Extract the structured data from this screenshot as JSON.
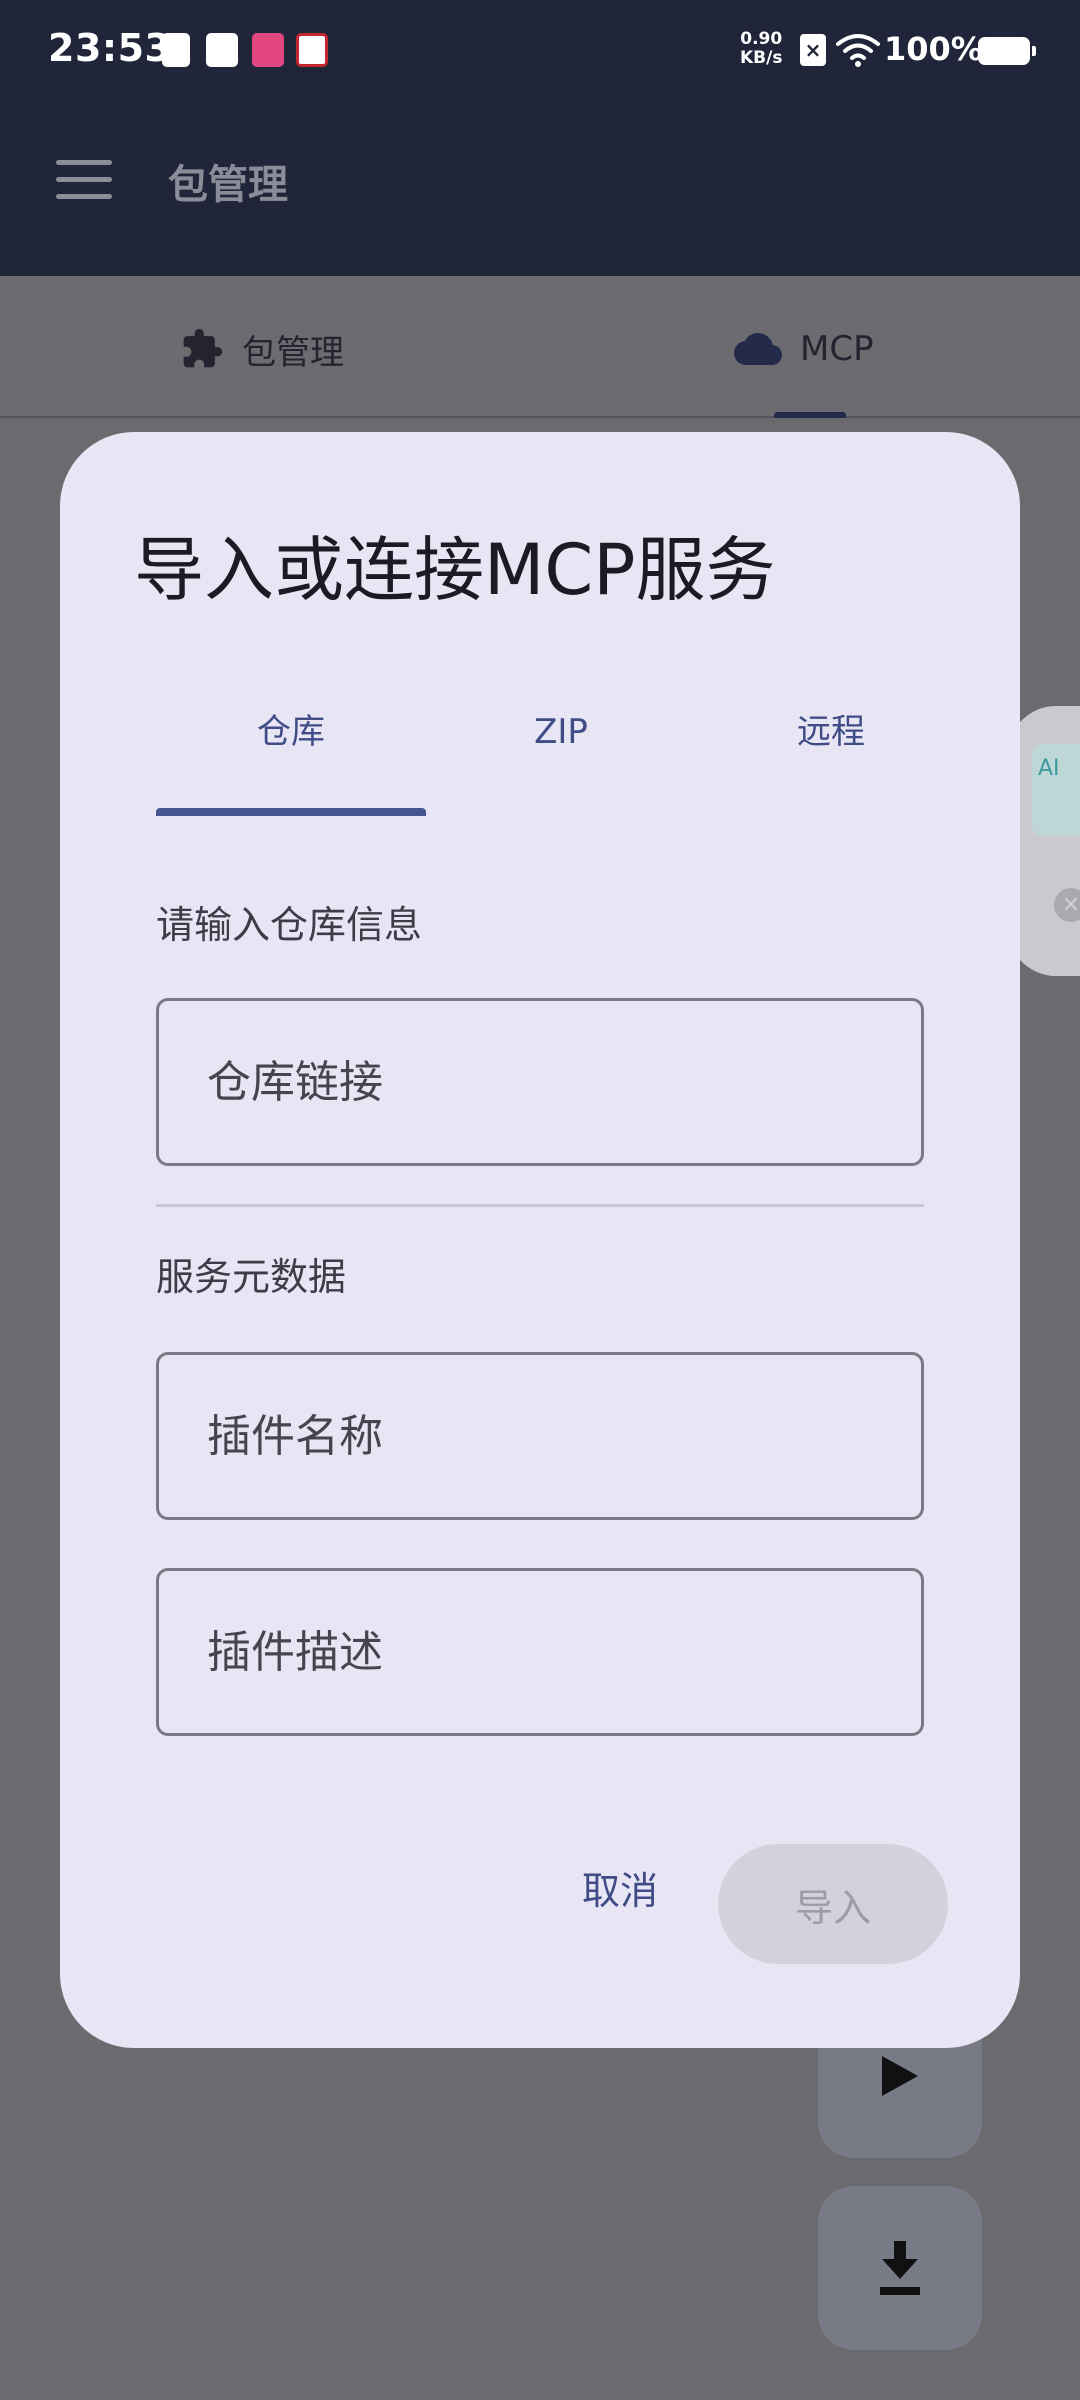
{
  "status_bar": {
    "time": "23:53",
    "net_speed_value": "0.90",
    "net_speed_unit": "KB/s",
    "battery": "100%"
  },
  "app_bar": {
    "title": "包管理"
  },
  "tabs": [
    {
      "label": "包管理",
      "icon": "puzzle-icon"
    },
    {
      "label": "MCP",
      "icon": "cloud-icon",
      "selected": true
    }
  ],
  "edge_widget": {
    "label": "AI"
  },
  "dialog": {
    "title": "导入或连接MCP服务",
    "tabs": [
      {
        "label": "仓库",
        "selected": true
      },
      {
        "label": "ZIP"
      },
      {
        "label": "远程"
      }
    ],
    "repo_section_label": "请输入仓库信息",
    "repo_link_placeholder": "仓库链接",
    "metadata_section_label": "服务元数据",
    "plugin_name_placeholder": "插件名称",
    "plugin_desc_placeholder": "插件描述",
    "cancel_label": "取消",
    "import_label": "导入"
  },
  "colors": {
    "accent": "#47558f",
    "dialog_bg": "#e8e6f4",
    "topbar_bg": "#20253a",
    "scrim": "#6b6b6f"
  }
}
